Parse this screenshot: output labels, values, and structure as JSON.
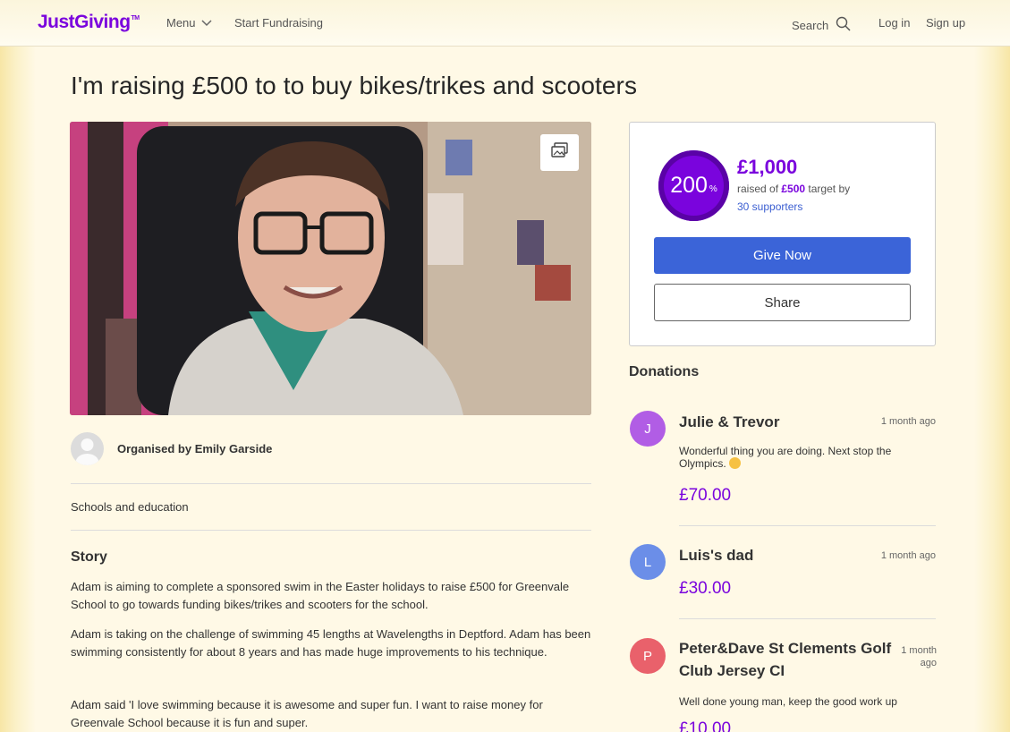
{
  "header": {
    "logo": "JustGiving",
    "menu_label": "Menu",
    "start_fundraising": "Start Fundraising",
    "search_label": "Search",
    "login": "Log in",
    "signup": "Sign up"
  },
  "page": {
    "title": "I'm raising £500 to to buy bikes/trikes and scooters",
    "organiser": "Organised by Emily Garside",
    "category": "Schools and education",
    "story_heading": "Story",
    "story_paragraphs": [
      "Adam is aiming to complete a sponsored swim in the Easter holidays to raise £500 for Greenvale School to go towards funding bikes/trikes and scooters for the school.",
      "Adam is taking on the challenge of swimming 45 lengths at Wavelengths in Deptford. Adam has been swimming consistently for about 8 years and has made huge improvements to his technique.",
      "Adam said 'I love swimming because it is awesome and super fun. I want to raise money for Greenvale School because it is fun and super."
    ]
  },
  "fundraising": {
    "percent": "200",
    "percent_sign": "%",
    "raised": "£1,000",
    "raised_prefix": "raised of",
    "target": "£500",
    "raised_suffix": "target by",
    "supporters": "30 supporters",
    "give_now": "Give Now",
    "share": "Share"
  },
  "donations": {
    "heading": "Donations",
    "items": [
      {
        "initial": "J",
        "name": "Julie & Trevor",
        "time": "1 month ago",
        "message": "Wonderful thing you are doing. Next stop the Olympics.",
        "amount": "£70.00",
        "color": "#b15de5"
      },
      {
        "initial": "L",
        "name": "Luis's dad",
        "time": "1 month ago",
        "message": "",
        "amount": "£30.00",
        "color": "#6b8ee8"
      },
      {
        "initial": "P",
        "name": "Peter&Dave St Clements Golf Club Jersey CI",
        "time": "1 month ago",
        "message": "Well done young man, keep the good work up",
        "amount": "£10.00",
        "color": "#e9616b"
      }
    ]
  },
  "colors": {
    "brand_purple": "#7a04dd",
    "give_button_blue": "#3b64d8",
    "link_blue": "#3b5ed1",
    "page_background": "#fff9e6"
  }
}
